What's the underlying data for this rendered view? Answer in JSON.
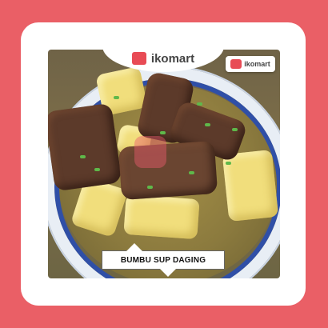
{
  "brand": {
    "name": "ikomart",
    "icon_text": "iko",
    "accent_color": "#ea5f66"
  },
  "title": "BUMBU SUP DAGING"
}
